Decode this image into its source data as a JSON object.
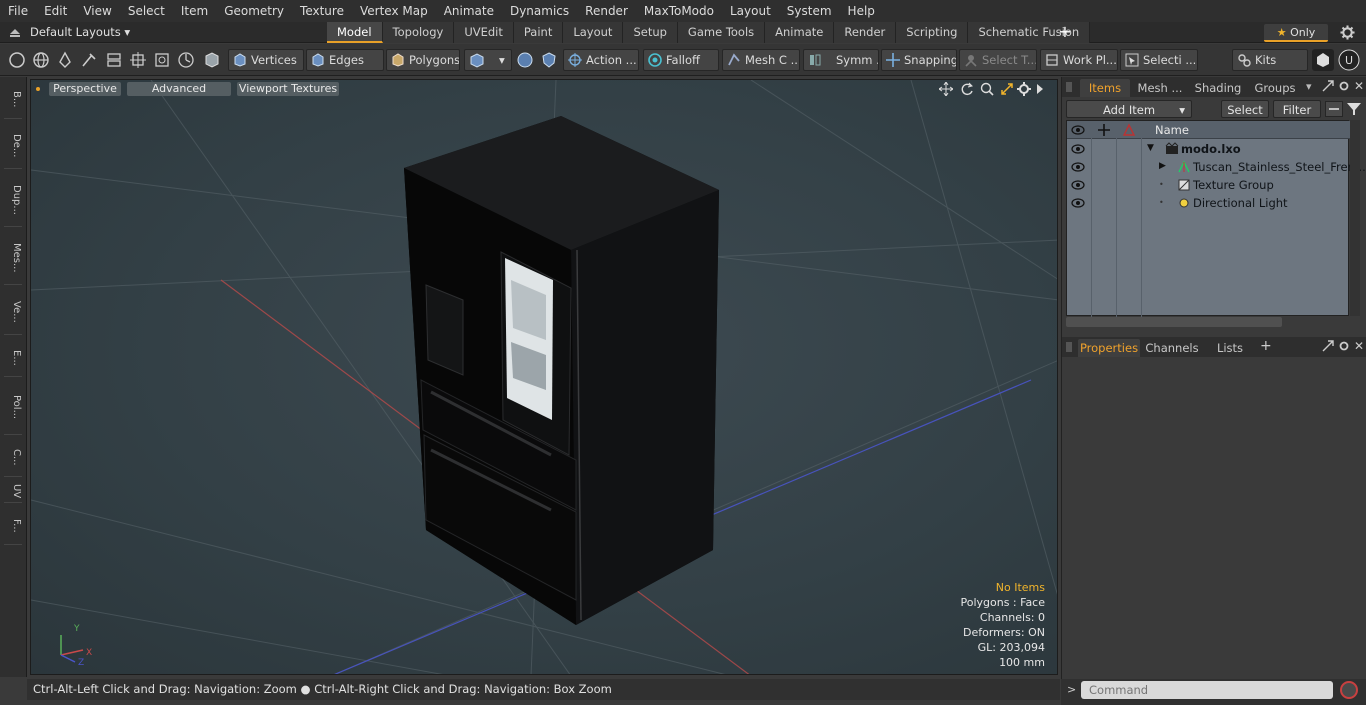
{
  "menubar": [
    "File",
    "Edit",
    "View",
    "Select",
    "Item",
    "Geometry",
    "Texture",
    "Vertex Map",
    "Animate",
    "Dynamics",
    "Render",
    "MaxToModo",
    "Layout",
    "System",
    "Help"
  ],
  "layoutbar": {
    "layouts_dropdown": "Default Layouts",
    "tabs": [
      "Model",
      "Topology",
      "UVEdit",
      "Paint",
      "Layout",
      "Setup",
      "Game Tools",
      "Animate",
      "Render",
      "Scripting",
      "Schematic Fusion"
    ],
    "active_tab": "Model",
    "only_label": "Only"
  },
  "toolbar": {
    "vertices": "Vertices",
    "edges": "Edges",
    "polygons": "Polygons",
    "action": "Action",
    "falloff": "Falloff",
    "mesh": "Mesh C ...",
    "symmetry": "Symm ...",
    "snapping": "Snapping",
    "select_t": "Select T...",
    "work_plane": "Work Pl...",
    "selection": "Selecti ...",
    "kits": "Kits"
  },
  "left_strip": [
    "B...",
    "De...",
    "Dup...",
    "Mes...",
    "Ve...",
    "E...",
    "Pol...",
    "C...",
    "UV",
    "F..."
  ],
  "viewport": {
    "perspective": "Perspective",
    "advanced": "Advanced",
    "viewport_textures": "Viewport Textures",
    "hud": {
      "no_items": "No Items",
      "polygons": "Polygons : Face",
      "channels": "Channels: 0",
      "deformers": "Deformers: ON",
      "gl": "GL: 203,094",
      "unit": "100 mm"
    },
    "axis": {
      "y": "Y",
      "x": "X",
      "z": "Z"
    }
  },
  "statusbar": {
    "hint1": "Ctrl-Alt-Left Click and Drag: Navigation: Zoom",
    "hint2": "Ctrl-Alt-Right Click and Drag: Navigation: Box Zoom"
  },
  "items_panel": {
    "tabs": [
      "Items",
      "Mesh ...",
      "Shading",
      "Groups"
    ],
    "active_tab": "Items",
    "add_item": "Add Item",
    "select": "Select",
    "filter": "Filter",
    "name_col": "Name",
    "tree": [
      {
        "label": "modo.lxo",
        "icon": "scene-icon",
        "bold": true
      },
      {
        "label": "Tuscan_Stainless_Steel_Fren ...",
        "icon": "mesh-icon",
        "bold": false
      },
      {
        "label": "Texture Group",
        "icon": "texture-group-icon",
        "bold": false
      },
      {
        "label": "Directional Light",
        "icon": "light-icon",
        "bold": false
      }
    ]
  },
  "properties_panel": {
    "tabs": [
      "Properties",
      "Channels",
      "Lists"
    ],
    "active_tab": "Properties"
  },
  "command": {
    "placeholder": "Command"
  },
  "colors": {
    "accent": "#e9a128",
    "viewport_bg": "#334046",
    "tree_bg": "#6d7680",
    "axis_x": "#c94a4a",
    "axis_z": "#4a55c9"
  }
}
